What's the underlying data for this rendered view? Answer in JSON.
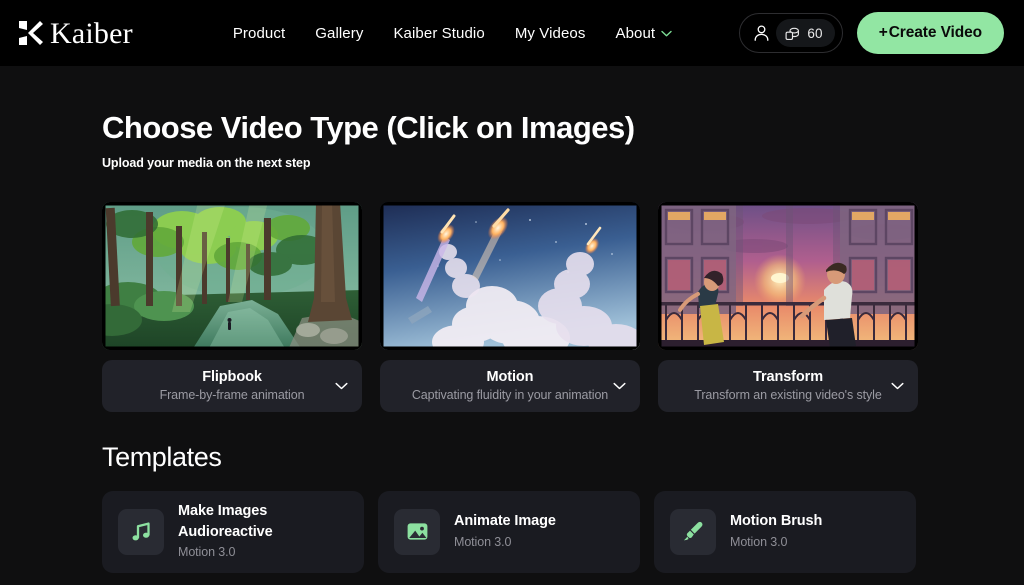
{
  "brand": {
    "name": "Kaiber",
    "logo_icon": "kaiber-logo-icon"
  },
  "nav": {
    "items": [
      {
        "label": "Product",
        "has_chevron": false
      },
      {
        "label": "Gallery",
        "has_chevron": false
      },
      {
        "label": "Kaiber Studio",
        "has_chevron": false
      },
      {
        "label": "My Videos",
        "has_chevron": false
      },
      {
        "label": "About",
        "has_chevron": true
      }
    ]
  },
  "account": {
    "user_icon": "user-icon",
    "credits_icon": "coins-icon",
    "credits_value": "60"
  },
  "create_button": {
    "label": "+ Create Video",
    "plus": "+",
    "text": "Create Video"
  },
  "page": {
    "title": "Choose Video Type (Click on Images)",
    "subtitle": "Upload your media on the next step"
  },
  "video_types": [
    {
      "title": "Flipbook",
      "description": "Frame-by-frame animation",
      "thumbnail_alt": "anime forest path with tall trees and a stream",
      "chevron_icon": "chevron-down-icon"
    },
    {
      "title": "Motion",
      "description": "Captivating fluidity in your animation",
      "thumbnail_alt": "rockets launching with smoke trails in a blue sky",
      "chevron_icon": "chevron-down-icon"
    },
    {
      "title": "Transform",
      "description": "Transform an existing video's style",
      "thumbnail_alt": "two people on a balcony at sunset",
      "chevron_icon": "chevron-down-icon"
    }
  ],
  "templates_section": {
    "title": "Templates"
  },
  "templates": [
    {
      "name": "Make Images Audioreactive",
      "model": "Motion 3.0",
      "icon": "music-note-icon"
    },
    {
      "name": "Animate Image",
      "model": "Motion 3.0",
      "icon": "image-icon"
    },
    {
      "name": "Motion Brush",
      "model": "Motion 3.0",
      "icon": "paint-brush-icon"
    }
  ],
  "colors": {
    "accent_green": "#92e6a3",
    "header_bg": "#000000",
    "page_bg": "#0f0f10",
    "card_bg": "#1a1b21",
    "label_bg": "#212229",
    "icon_tile_bg": "#292b33",
    "muted_text": "#9b9ba3"
  }
}
